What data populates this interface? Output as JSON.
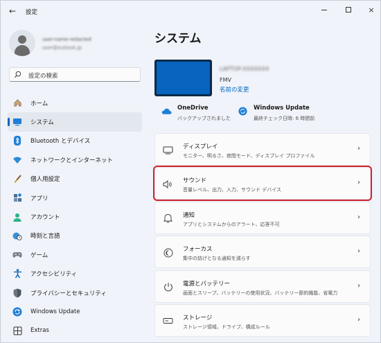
{
  "window": {
    "title": "設定",
    "back_glyph": "←",
    "controls": {
      "minimize": "minimize-icon",
      "maximize": "maximize-icon",
      "close": "×"
    }
  },
  "profile": {
    "name": "user-name-redacted",
    "email": "user@outlook.jp"
  },
  "search": {
    "placeholder": "設定の検索"
  },
  "sidebar": {
    "items": [
      {
        "label": "ホーム",
        "icon": "home-icon",
        "active": false
      },
      {
        "label": "システム",
        "icon": "system-icon",
        "active": true
      },
      {
        "label": "Bluetooth とデバイス",
        "icon": "bluetooth-icon",
        "active": false
      },
      {
        "label": "ネットワークとインターネット",
        "icon": "wifi-icon",
        "active": false
      },
      {
        "label": "個人用設定",
        "icon": "brush-icon",
        "active": false
      },
      {
        "label": "アプリ",
        "icon": "apps-icon",
        "active": false
      },
      {
        "label": "アカウント",
        "icon": "account-icon",
        "active": false
      },
      {
        "label": "時刻と言語",
        "icon": "globe-clock-icon",
        "active": false
      },
      {
        "label": "ゲーム",
        "icon": "gamepad-icon",
        "active": false
      },
      {
        "label": "アクセシビリティ",
        "icon": "accessibility-icon",
        "active": false
      },
      {
        "label": "プライバシーとセキュリティ",
        "icon": "shield-icon",
        "active": false
      },
      {
        "label": "Windows Update",
        "icon": "update-icon",
        "active": false
      },
      {
        "label": "Extras",
        "icon": "extras-icon",
        "active": false
      }
    ]
  },
  "main": {
    "title": "システム",
    "device": {
      "name": "LAPTOP-XXXXXXX",
      "model": "FMV",
      "rename": "名前の変更"
    },
    "status": {
      "onedrive": {
        "title": "OneDrive",
        "sub": "バックアップされました"
      },
      "update": {
        "title": "Windows Update",
        "sub": "最終チェック日時: 6 時間前"
      }
    },
    "cards": [
      {
        "title": "ディスプレイ",
        "sub": "モニター、明るさ、夜間モード、ディスプレイ プロファイル",
        "icon": "display-icon",
        "highlight": false
      },
      {
        "title": "サウンド",
        "sub": "音量レベル、出力、入力、サウンド デバイス",
        "icon": "speaker-icon",
        "highlight": true
      },
      {
        "title": "通知",
        "sub": "アプリとシステムからのアラート、応答不可",
        "icon": "bell-icon",
        "highlight": false
      },
      {
        "title": "フォーカス",
        "sub": "集中の妨げとなる通知を減らす",
        "icon": "focus-icon",
        "highlight": false
      },
      {
        "title": "電源とバッテリー",
        "sub": "画面とスリープ、バッテリーの使用状況、バッテリー節約機能、省電力",
        "icon": "power-icon",
        "highlight": false
      },
      {
        "title": "ストレージ",
        "sub": "ストレージ領域、ドライブ、構成ルール",
        "icon": "storage-icon",
        "highlight": false
      }
    ],
    "chevron": "›"
  },
  "colors": {
    "accent": "#0067c0",
    "highlight_border": "#d3212e",
    "background": "#f0f3f9"
  }
}
